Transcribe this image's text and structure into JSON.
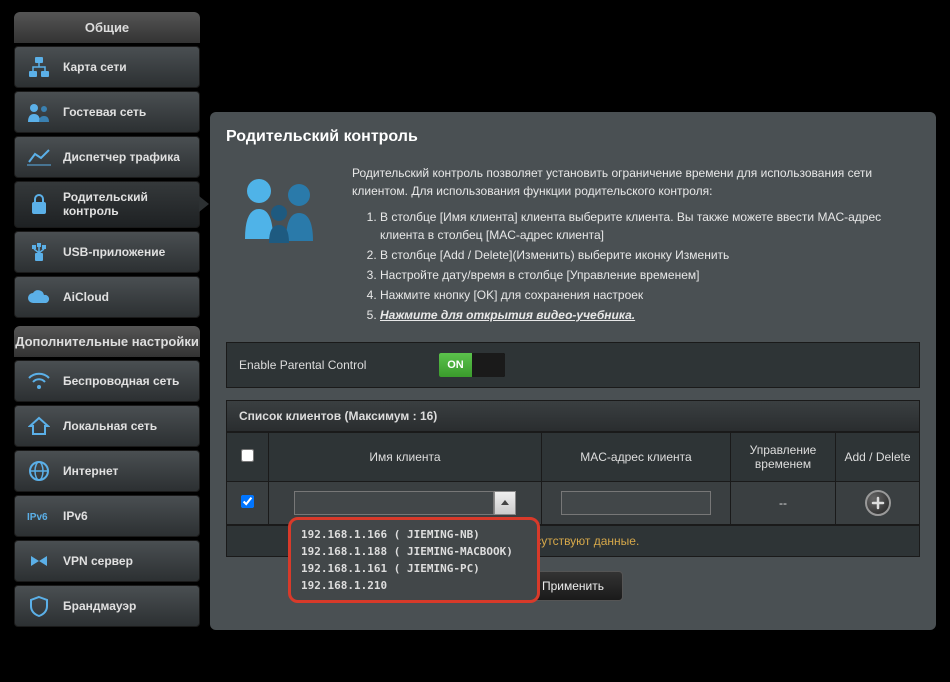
{
  "sidebar": {
    "header_general": "Общие",
    "header_advanced": "Дополнительные настройки",
    "general": [
      {
        "label": "Карта сети",
        "icon": "network-map"
      },
      {
        "label": "Гостевая сеть",
        "icon": "guest"
      },
      {
        "label": "Диспетчер трафика",
        "icon": "traffic"
      },
      {
        "label": "Родительский контроль",
        "icon": "lock",
        "active": true
      },
      {
        "label": "USB-приложение",
        "icon": "usb"
      },
      {
        "label": "AiCloud",
        "icon": "cloud"
      }
    ],
    "advanced": [
      {
        "label": "Беспроводная сеть",
        "icon": "wifi"
      },
      {
        "label": "Локальная сеть",
        "icon": "home"
      },
      {
        "label": "Интернет",
        "icon": "globe"
      },
      {
        "label": "IPv6",
        "icon": "ipv6"
      },
      {
        "label": "VPN сервер",
        "icon": "vpn"
      },
      {
        "label": "Брандмауэр",
        "icon": "shield"
      }
    ]
  },
  "page": {
    "title": "Родительский контроль",
    "intro": "Родительский контроль позволяет установить ограничение времени для использования сети клиентом. Для использования функции родительского контроля:",
    "steps": [
      "В столбце [Имя клиента] клиента выберите клиента. Вы также можете ввести MAC-адрес клиента в столбец [MAC-адрес клиента]",
      "В столбце [Add / Delete](Изменить) выберите иконку Изменить",
      "Настройте дату/время в столбце [Управление временем]",
      "Нажмите кнопку [OK] для сохранения настроек"
    ],
    "video_link": "Нажмите для открытия видео-учебника.",
    "enable_label": "Enable Parental Control",
    "enable_state": "ON",
    "clients_header": "Список клиентов (Максимум : 16)",
    "columns": {
      "name": "Имя клиента",
      "mac": "MAC-адрес клиента",
      "time": "Управление временем",
      "add": "Add / Delete"
    },
    "time_placeholder": "--",
    "dropdown": [
      "192.168.1.166 ( JIEMING-NB)",
      "192.168.1.188 ( JIEMING-MACBOOK)",
      "192.168.1.161 ( JIEMING-PC)",
      "192.168.1.210"
    ],
    "no_data": "це отсутствуют данные.",
    "apply": "Применить"
  }
}
